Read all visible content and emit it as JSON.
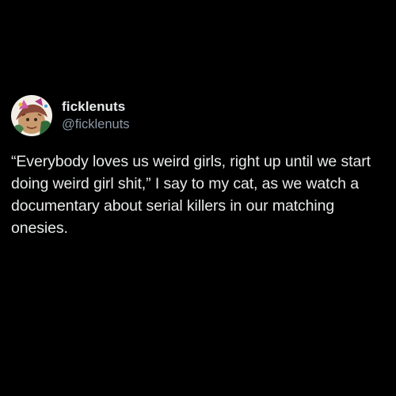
{
  "tweet": {
    "display_name": "ficklenuts",
    "handle": "@ficklenuts",
    "text": "“Everybody loves us weird girls, right up until we start doing weird girl shit,” I say to my cat, as we watch a documentary about serial killers in our matching onesies.",
    "avatar_icon": "avatar-illustration-icon"
  },
  "colors": {
    "background": "#000000",
    "text_primary": "#e7e9ea",
    "text_secondary": "#8b98a5"
  }
}
